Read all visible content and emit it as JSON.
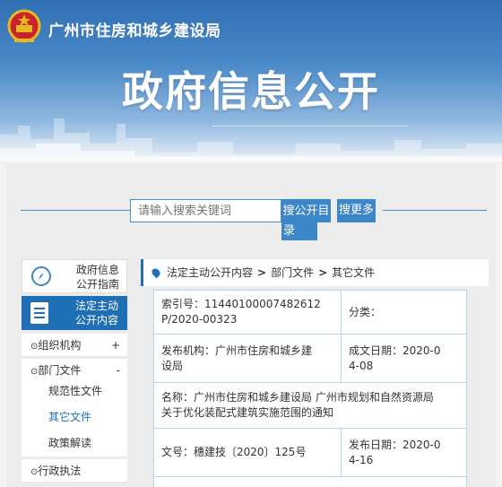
{
  "header": {
    "site_title": "广州市住房和城乡建设局",
    "banner_title": "政府信息公开"
  },
  "search": {
    "placeholder": "请输入搜索关键词",
    "search_button": "搜公开目录",
    "search_button_line1": "搜公开目",
    "search_button_line2": "录",
    "more_button": "搜更多"
  },
  "sidebar": {
    "guide": {
      "label_line1": "政府信息",
      "label_line2": "公开指南"
    },
    "active": {
      "label_line1": "法定主动",
      "label_line2": "公开内容"
    },
    "menu": [
      {
        "label": "组织机构",
        "sign": "+"
      },
      {
        "label": "部门文件",
        "sign": "-"
      },
      {
        "label": "行政执法",
        "sign": ""
      }
    ],
    "submenu": [
      "规范性文件",
      "其它文件",
      "政策解读"
    ],
    "active_sub": "其它文件"
  },
  "breadcrumb": [
    "法定主动公开内容",
    "部门文件",
    "其它文件"
  ],
  "doc_info": {
    "index_no": "索引号：11440100007482612P/2020-00323",
    "index_no_line1": "索引号：114401000074826​12",
    "index_no_line2": "P/2020-00323",
    "category": "分类：",
    "issuer_line1": "发布机构：广州市住房和城乡建",
    "issuer_line2": "设局",
    "issuer": "发布机构：广州市住房和城乡建设局",
    "created_line1": "成文日期：2020-0",
    "created_line2": "4-08",
    "created": "成文日期：2020-04-08",
    "title_line1": "名称：广州市住房和城乡建设局 广州市规划和自然资源局",
    "title_line2": "关于优化装配式建筑实施范围的通知",
    "doc_no": "文号：穗建技〔2020〕125号",
    "published_line1": "发布日期：2020-0",
    "published_line2": "4-16",
    "published": "发布日期：2020-04-16"
  },
  "colors": {
    "primary": "#1e6fb6",
    "accent": "#3b87c9",
    "border": "#b8d6ea"
  }
}
